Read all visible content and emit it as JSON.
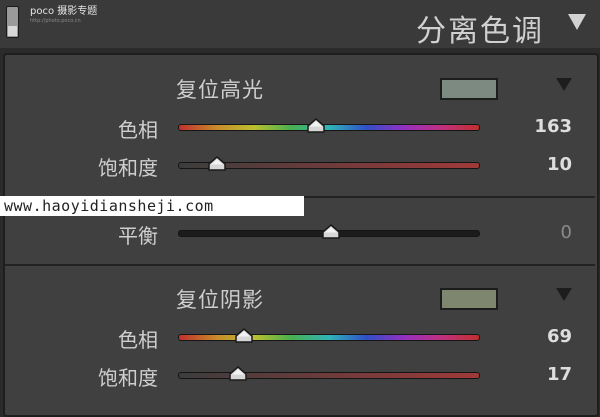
{
  "header": {
    "title": "分离色调",
    "logo_text": "poco 摄影专题",
    "logo_sub": "http://photo.poco.cn"
  },
  "highlights": {
    "reset_label": "复位高光",
    "swatch_color": "#7d8a82",
    "hue": {
      "label": "色相",
      "value": "163",
      "position": 0.46
    },
    "saturation": {
      "label": "饱和度",
      "value": "10",
      "position": 0.13
    }
  },
  "balance": {
    "label": "平衡",
    "value": "0",
    "position": 0.51
  },
  "shadows": {
    "reset_label": "复位阴影",
    "swatch_color": "#7f8670",
    "hue": {
      "label": "色相",
      "value": "69",
      "position": 0.22
    },
    "saturation": {
      "label": "饱和度",
      "value": "17",
      "position": 0.2
    }
  },
  "watermark": "www.haoyidiansheji.com"
}
